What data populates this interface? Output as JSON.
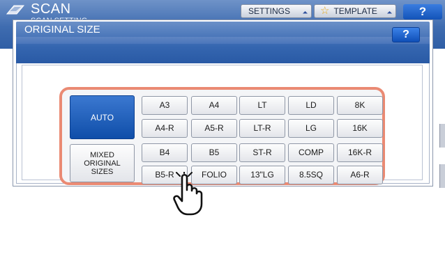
{
  "background": {
    "title": "SCAN",
    "subtitle": "SCAN SETTING",
    "settings_button": "SETTINGS",
    "template_button": "TEMPLATE",
    "help_button": "?"
  },
  "dialog": {
    "title": "ORIGINAL SIZE",
    "help_button": "?"
  },
  "sizes": {
    "auto": "AUTO",
    "mixed": [
      "MIXED",
      "ORIGINAL",
      "SIZES"
    ],
    "row1": [
      "A3",
      "A4",
      "LT",
      "LD",
      "8K"
    ],
    "row2": [
      "A4-R",
      "A5-R",
      "LT-R",
      "LG",
      "16K"
    ],
    "row3": [
      "B4",
      "B5",
      "ST-R",
      "COMP",
      "16K-R"
    ],
    "row4": [
      "B5-R",
      "FOLIO",
      "13\"LG",
      "8.5SQ",
      "A6-R"
    ]
  },
  "icons": {
    "scan": "scan-icon",
    "star": "star-icon",
    "pointer": "hand-pointer-icon"
  },
  "colors": {
    "selected": "#1a5bb8",
    "highlight": "#ea8a73",
    "header": "#3f6cb0"
  }
}
